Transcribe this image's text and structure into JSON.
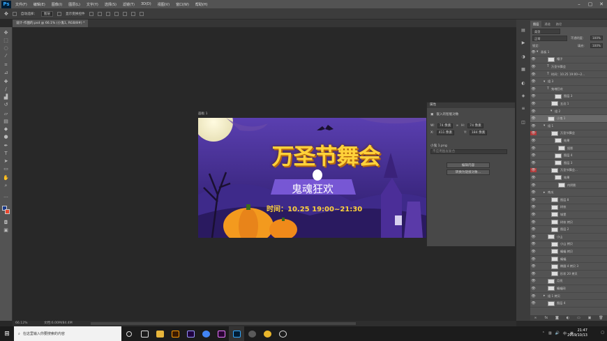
{
  "app": {
    "logo": "Ps",
    "menus": [
      "文件(F)",
      "编辑(E)",
      "图像(I)",
      "图层(L)",
      "文字(Y)",
      "选择(S)",
      "滤镜(T)",
      "3D(D)",
      "视图(V)",
      "窗口(W)",
      "帮助(H)"
    ],
    "win": [
      "–",
      "▢",
      "✕"
    ]
  },
  "options": {
    "auto_select_label": "自动选择：",
    "auto_select_value": "图层",
    "transform_label": "显示变换控件"
  },
  "document": {
    "tab": "设计-作图的.psd @ 66.1% (小鬼1, RGB/8#) *",
    "artboard": "画板 1",
    "status_zoom": "66.12%",
    "status_doc": "文档:6.00M/84.4M"
  },
  "banner": {
    "title": "万圣节舞会",
    "subtitle": "鬼魂狂欢",
    "time": "时间：10.25 19:00~21:30"
  },
  "properties": {
    "title": "属性",
    "type": "嵌入的智能对象",
    "w_label": "W:",
    "w_value": "74 像素",
    "h_label": "H:",
    "h_value": "74 像素",
    "x_label": "X:",
    "x_value": "411 像素",
    "y_label": "Y:",
    "y_value": "184 像素",
    "file": "小鬼 1.png",
    "comp_placeholder": "不应用图层复合",
    "btn_edit": "编辑内容",
    "btn_convert": "转换为链接对象..."
  },
  "layers_panel": {
    "tabs": [
      "图层",
      "通道",
      "路径"
    ],
    "kind": "类型",
    "blend": "正常",
    "opacity_label": "不透明度:",
    "opacity": "100%",
    "lock_label": "锁定:",
    "fill_label": "填充:",
    "fill": "100%",
    "rows": [
      "画板 1",
      "帽子",
      "万圣节舞会",
      "时间：10.25 19:00~2...",
      "组 3",
      "鬼魂狂欢",
      "图层 3",
      "五边 1",
      "组 2",
      "小鬼 1",
      "组 1",
      "万圣节舞会",
      "效果",
      "投影",
      "图层 4",
      "图层 3",
      "万圣节舞会...",
      "效果",
      "内阴影",
      "南瓜",
      "图层 8",
      "树枝",
      "城堡",
      "树枝 拷贝",
      "图层 2",
      "小山",
      "小山 拷贝",
      "蝙蝠 拷贝",
      "蝙蝠",
      "椭圆 4 拷贝 3",
      "形状 20 拷贝",
      "月亮",
      "蝙蝠网",
      "组 1 拷贝",
      "图层 4"
    ]
  },
  "taskbar": {
    "search_placeholder": "在这里输入你要搜索的内容",
    "time": "21:47",
    "date": "2019/10/13",
    "lang": "中",
    "ime": "英"
  },
  "icons": [
    "move-icon",
    "marquee-icon",
    "lasso-icon",
    "magic-wand-icon",
    "crop-icon",
    "eyedropper-icon",
    "healing-icon",
    "brush-icon",
    "stamp-icon",
    "history-brush-icon",
    "eraser-icon",
    "gradient-icon",
    "blur-icon",
    "dodge-icon",
    "pen-icon",
    "type-icon",
    "path-select-icon",
    "shape-icon",
    "hand-icon",
    "zoom-icon"
  ]
}
